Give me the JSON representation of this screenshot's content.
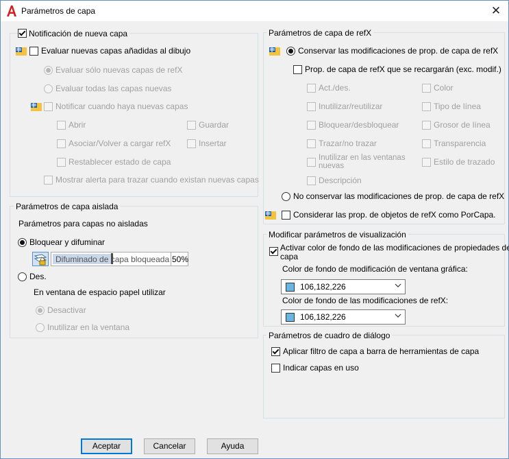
{
  "window": {
    "title": "Parámetros de capa"
  },
  "colors": {
    "accent": "#0078d7",
    "swatch": "#6ab6e2",
    "app_icon": "#d51e1e"
  },
  "new_layer": {
    "legend": "Notificación de nueva capa",
    "evaluate": "Evaluar nuevas capas añadidas al dibujo",
    "eval_xref_only": "Evaluar sólo nuevas capas de refX",
    "eval_all": "Evaluar todas las capas nuevas",
    "notify": "Notificar cuando haya nuevas capas",
    "open": "Abrir",
    "save": "Guardar",
    "attach": "Asociar/Volver a cargar refX",
    "insert": "Insertar",
    "restore": "Restablecer estado de capa",
    "alert": "Mostrar alerta para trazar cuando existan nuevas capas"
  },
  "isolate": {
    "legend": "Parámetros de capa aislada",
    "subtitle": "Parámetros para capas no aisladas",
    "lock_fade": "Bloquear y difuminar",
    "fade_label": "Difuminado de capa bloqueada",
    "fade_value": "50%",
    "off": "Des.",
    "paper_space": "En ventana de espacio papel utilizar",
    "deactivate": "Desactivar",
    "freeze_vp": "Inutilizar en la ventana"
  },
  "xref": {
    "legend": "Parámetros de capa de refX",
    "keep": "Conservar las modificaciones de prop. de capa de refX",
    "reload_props": "Prop. de capa de refX que se recargarán (exc. modif.)",
    "onoff": "Act./des.",
    "color": "Color",
    "freeze": "Inutilizar/reutilizar",
    "linetype": "Tipo de línea",
    "lock": "Bloquear/desbloquear",
    "lineweight": "Grosor de línea",
    "plot": "Trazar/no trazar",
    "transparency": "Transparencia",
    "vp_freeze_1": "Inutilizar en las ventanas",
    "vp_freeze_2": "nuevas",
    "plotstyle": "Estilo de trazado",
    "description": "Descripción",
    "dont_keep": "No conservar las modificaciones de prop. de capa de refX",
    "bylayer": "Considerar las prop. de objetos de refX como PorCapa."
  },
  "display": {
    "legend": "Modificar parámetros de visualización",
    "bg_check_1": "Activar color de fondo de las modificaciones de propiedades de",
    "bg_check_2": "capa",
    "vp_label": "Color de fondo de modificación de ventana gráfica:",
    "vp_value": "106,182,226",
    "xref_label": "Color de fondo de las modificaciones de refX:",
    "xref_value": "106,182,226"
  },
  "dialog": {
    "legend": "Parámetros de cuadro de diálogo",
    "apply_filter": "Aplicar filtro de capa a barra de herramientas de capa",
    "indicate": "Indicar capas en uso"
  },
  "buttons": {
    "ok": "Aceptar",
    "cancel": "Cancelar",
    "help": "Ayuda"
  }
}
